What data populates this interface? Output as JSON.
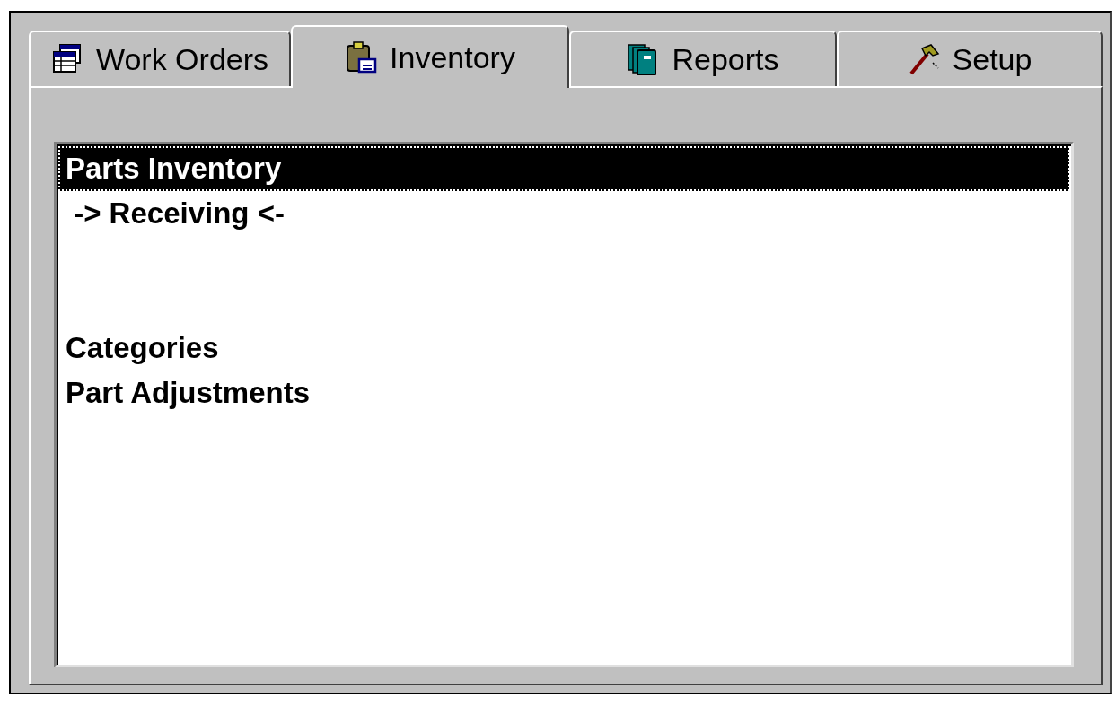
{
  "tabs": [
    {
      "label": "Work Orders",
      "selected": false
    },
    {
      "label": "Inventory",
      "selected": true
    },
    {
      "label": "Reports",
      "selected": false
    },
    {
      "label": "Setup",
      "selected": false
    }
  ],
  "list": {
    "items": [
      {
        "kind": "item",
        "label": "Parts Inventory",
        "selected": true
      },
      {
        "kind": "item",
        "label": " -> Receiving <-",
        "selected": false
      },
      {
        "kind": "blank"
      },
      {
        "kind": "blank"
      },
      {
        "kind": "item",
        "label": "Categories",
        "selected": false
      },
      {
        "kind": "item",
        "label": "Part Adjustments",
        "selected": false
      }
    ]
  }
}
